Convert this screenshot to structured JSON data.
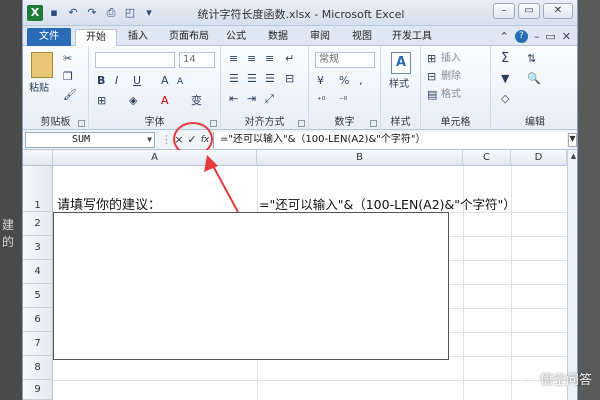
{
  "window": {
    "title": "统计字符长度函数.xlsx - Microsoft Excel"
  },
  "ribbon": {
    "tabs": [
      "文件",
      "开始",
      "插入",
      "页面布局",
      "公式",
      "数据",
      "审阅",
      "视图",
      "开发工具"
    ],
    "groups": {
      "clipboard": {
        "label": "剪贴板",
        "paste": "粘贴"
      },
      "font": {
        "label": "字体",
        "size": "14",
        "bold": "B",
        "italic": "I",
        "underline": "U",
        "grow": "A",
        "shrink": "A",
        "wen": "变"
      },
      "alignment": {
        "label": "对齐方式"
      },
      "number": {
        "label": "数字",
        "format": "常规",
        "percent": "%",
        "comma": ","
      },
      "styles": {
        "label": "样式",
        "styles_btn": "样式"
      },
      "cells": {
        "label": "单元格",
        "insert": "插入",
        "delete": "删除",
        "format": "格式"
      },
      "editing": {
        "label": "编辑",
        "sum": "Σ"
      }
    }
  },
  "formula_bar": {
    "name_box": "SUM",
    "cancel": "×",
    "enter": "✓",
    "fx": "fx",
    "formula": "=\"还可以输入\"&（100-LEN(A2)&\"个字符\"）"
  },
  "sheet": {
    "columns": [
      "A",
      "B",
      "C",
      "D"
    ],
    "rows": [
      "1",
      "2",
      "3",
      "4",
      "5",
      "6",
      "7",
      "8",
      "9"
    ],
    "cells": {
      "A1": "请填写你的建议：",
      "B1": "=\"还可以输入\"&（100-LEN(A2)&\"个字符\"）"
    }
  },
  "overlay": {
    "watermark": "悟空问答",
    "left_fragment": "建的"
  },
  "colors": {
    "file_tab": "#2a6bb7",
    "highlight": "#e23c3c",
    "excel_green": "#1e7b3a"
  }
}
